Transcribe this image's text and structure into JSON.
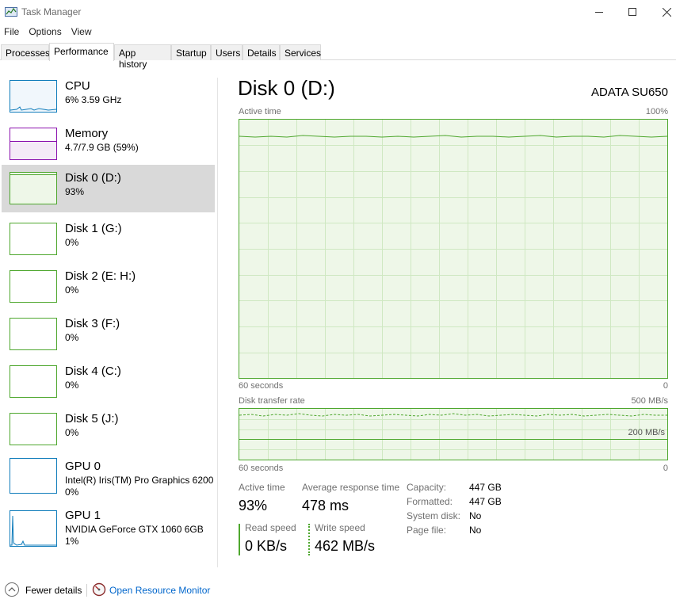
{
  "window": {
    "title": "Task Manager"
  },
  "menu": [
    "File",
    "Options",
    "View"
  ],
  "tabs": [
    "Processes",
    "Performance",
    "App history",
    "Startup",
    "Users",
    "Details",
    "Services"
  ],
  "sidebar": {
    "items": [
      {
        "name": "CPU",
        "sub": "6% 3.59 GHz",
        "sub2": ""
      },
      {
        "name": "Memory",
        "sub": "4.7/7.9 GB (59%)",
        "sub2": ""
      },
      {
        "name": "Disk 0 (D:)",
        "sub": "93%",
        "sub2": ""
      },
      {
        "name": "Disk 1 (G:)",
        "sub": "0%",
        "sub2": ""
      },
      {
        "name": "Disk 2 (E: H:)",
        "sub": "0%",
        "sub2": ""
      },
      {
        "name": "Disk 3 (F:)",
        "sub": "0%",
        "sub2": ""
      },
      {
        "name": "Disk 4 (C:)",
        "sub": "0%",
        "sub2": ""
      },
      {
        "name": "Disk 5 (J:)",
        "sub": "0%",
        "sub2": ""
      },
      {
        "name": "GPU 0",
        "sub": "Intel(R) Iris(TM) Pro Graphics 6200",
        "sub2": "0%"
      },
      {
        "name": "GPU 1",
        "sub": "NVIDIA GeForce GTX 1060 6GB",
        "sub2": "1%"
      }
    ]
  },
  "main": {
    "title": "Disk 0 (D:)",
    "model": "ADATA SU650",
    "graph1": {
      "label": "Active time",
      "max_label": "100%",
      "time_label": "60 seconds",
      "min_label": "0"
    },
    "graph2": {
      "label": "Disk transfer rate",
      "max_label": "500 MB/s",
      "mid_label": "200 MB/s",
      "time_label": "60 seconds",
      "min_label": "0"
    },
    "stats": {
      "active_time_label": "Active time",
      "active_time_value": "93%",
      "avg_response_label": "Average response time",
      "avg_response_value": "478 ms",
      "read_label": "Read speed",
      "read_value": "0 KB/s",
      "write_label": "Write speed",
      "write_value": "462 MB/s"
    },
    "props": [
      {
        "key": "Capacity:",
        "value": "447 GB"
      },
      {
        "key": "Formatted:",
        "value": "447 GB"
      },
      {
        "key": "System disk:",
        "value": "No"
      },
      {
        "key": "Page file:",
        "value": "No"
      }
    ]
  },
  "footer": {
    "fewer_details": "Fewer details",
    "resource_monitor": "Open Resource Monitor"
  },
  "colors": {
    "disk_green": "#4ea72e",
    "memory_purple": "#8b12ae",
    "cpu_blue": "#117dbb",
    "graph_fill": "#eef7e8"
  }
}
